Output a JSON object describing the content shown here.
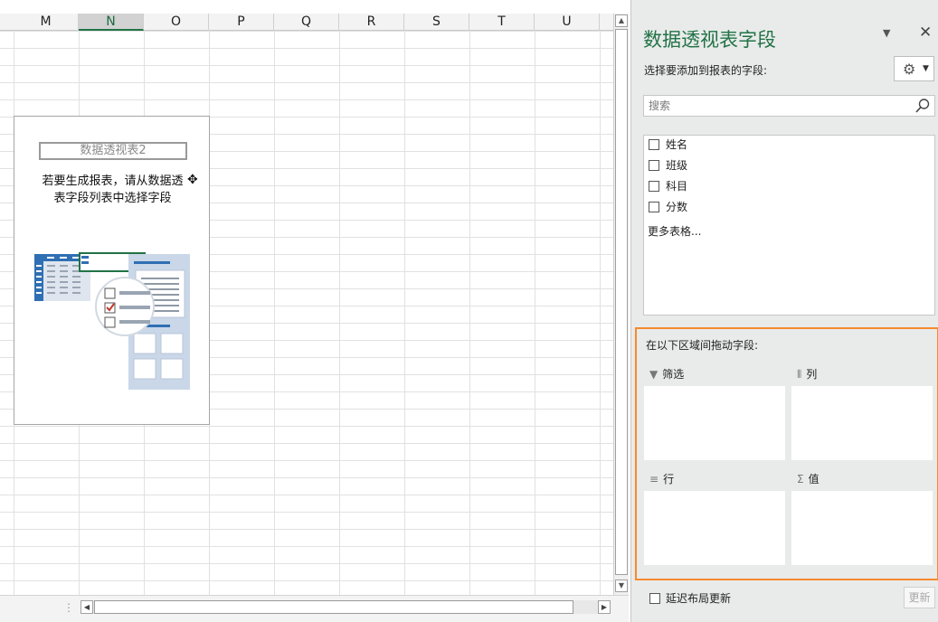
{
  "sheet": {
    "columns": [
      "M",
      "N",
      "O",
      "P",
      "Q",
      "R",
      "S",
      "T",
      "U"
    ],
    "selected_column": "N",
    "pivot_placeholder": {
      "name": "数据透视表2",
      "hint_line1": "若要生成报表，请从数据透",
      "hint_line2": "表字段列表中选择字段"
    }
  },
  "pane": {
    "title": "数据透视表字段",
    "choose_fields_label": "选择要添加到报表的字段:",
    "search": {
      "placeholder": "搜索",
      "value": ""
    },
    "fields": [
      {
        "label": "姓名",
        "checked": false
      },
      {
        "label": "班级",
        "checked": false
      },
      {
        "label": "科目",
        "checked": false
      },
      {
        "label": "分数",
        "checked": false
      }
    ],
    "more_tables": "更多表格...",
    "areas_label": "在以下区域间拖动字段:",
    "areas": {
      "filters": {
        "label": "筛选",
        "icon": "filter-icon"
      },
      "columns": {
        "label": "列",
        "icon": "columns-icon"
      },
      "rows": {
        "label": "行",
        "icon": "rows-icon"
      },
      "values": {
        "label": "值",
        "icon": "sigma-icon"
      }
    },
    "defer_update": {
      "label": "延迟布局更新",
      "checked": false
    },
    "update_button": "更新"
  },
  "colors": {
    "accent_green": "#217346",
    "highlight_orange": "#f58a2f",
    "pane_background": "#e9ebea"
  }
}
